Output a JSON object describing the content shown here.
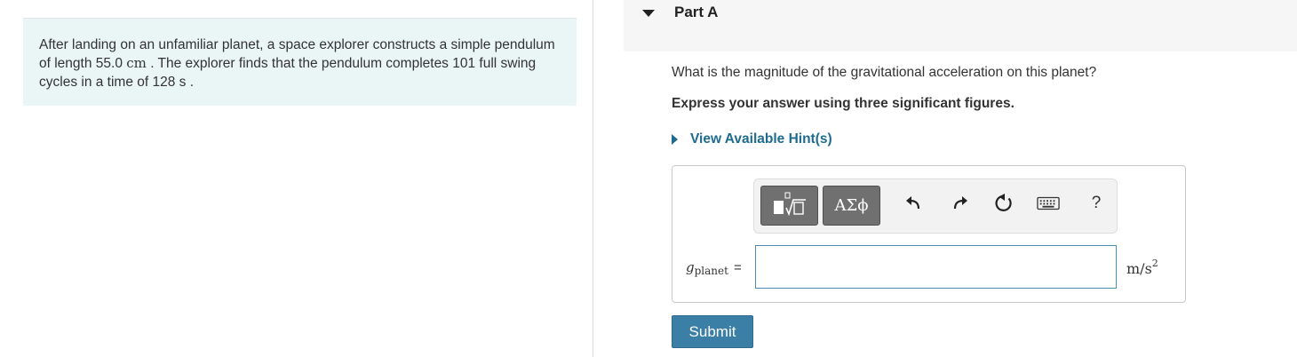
{
  "problem": {
    "text_1": "After landing on an unfamiliar planet, a space explorer constructs a simple pendulum of length ",
    "length_value": "55.0",
    "length_unit": "cm",
    "text_2": " . The explorer finds that the pendulum completes 101 full swing cycles in a time of 128",
    "time_unit": "s",
    "text_3": " ."
  },
  "part": {
    "title": "Part A",
    "question": "What is the magnitude of the gravitational acceleration on this planet?",
    "instruction": "Express your answer using three significant figures.",
    "hint_label": "View Available Hint(s)"
  },
  "toolbar": {
    "templates_icon": "templates-icon",
    "greek_label": "ΑΣϕ",
    "undo_icon": "undo-icon",
    "redo_icon": "redo-icon",
    "reset_icon": "reset-icon",
    "keyboard_icon": "keyboard-icon",
    "help_label": "?"
  },
  "answer": {
    "variable": "g",
    "subscript": "planet",
    "equals": "=",
    "value": "",
    "unit_base": "m/s",
    "unit_exp": "2"
  },
  "submit_label": "Submit",
  "colors": {
    "problem_bg": "#eaf5f6",
    "link": "#1e6b8f",
    "submit_bg": "#3b7fa7",
    "input_border": "#4a8eb0",
    "toolbar_button": "#707070"
  }
}
